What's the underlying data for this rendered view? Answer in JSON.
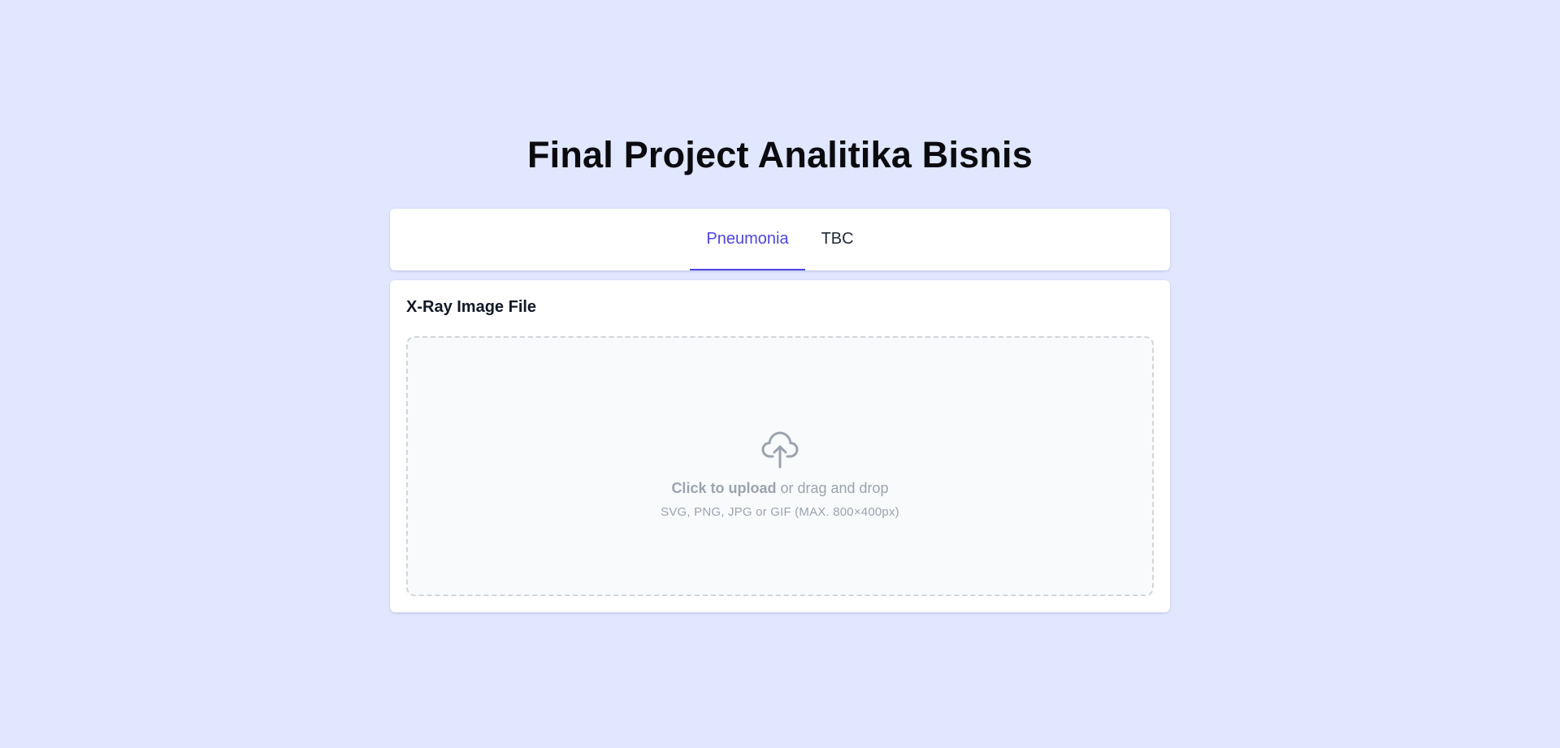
{
  "header": {
    "title": "Final Project Analitika Bisnis"
  },
  "tabs": [
    {
      "label": "Pneumonia",
      "active": true
    },
    {
      "label": "TBC",
      "active": false
    }
  ],
  "upload": {
    "field_label": "X-Ray Image File",
    "icon": "cloud-upload-icon",
    "click_label": "Click to upload",
    "drag_label": "or drag and drop",
    "hint": "SVG, PNG, JPG or GIF (MAX. 800×400px)"
  },
  "colors": {
    "background": "#e0e7ff",
    "accent": "#4f46e5",
    "muted": "#9ca3af"
  }
}
